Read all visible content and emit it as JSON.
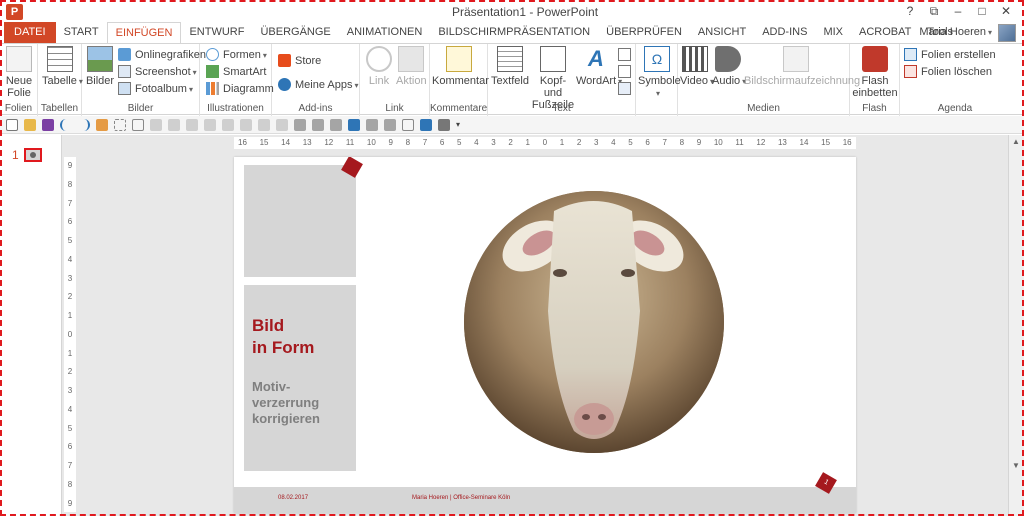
{
  "window": {
    "title": "Präsentation1 - PowerPoint",
    "help": "?",
    "ribbon_opts": "⧉",
    "minimize": "–",
    "maximize": "□",
    "close": "✕"
  },
  "app_logo": "P",
  "tabs": [
    "DATEI",
    "START",
    "EINFÜGEN",
    "ENTWURF",
    "ÜBERGÄNGE",
    "ANIMATIONEN",
    "BILDSCHIRMPRÄSENTATION",
    "ÜBERPRÜFEN",
    "ANSICHT",
    "ADD-INS",
    "MIX",
    "ACROBAT",
    "Tools"
  ],
  "active_tab": "EINFÜGEN",
  "user": {
    "name": "Maria Hoeren"
  },
  "ribbon": {
    "folien": {
      "label": "Folien",
      "neue_folie": "Neue\nFolie"
    },
    "tabellen": {
      "label": "Tabellen",
      "tabelle": "Tabelle"
    },
    "bilder": {
      "label": "Bilder",
      "bilder": "Bilder",
      "onlinegrafiken": "Onlinegrafiken",
      "screenshot": "Screenshot",
      "fotoalbum": "Fotoalbum"
    },
    "illustrationen": {
      "label": "Illustrationen",
      "formen": "Formen",
      "smartart": "SmartArt",
      "diagramm": "Diagramm"
    },
    "addins": {
      "label": "Add-ins",
      "store": "Store",
      "meine_apps": "Meine Apps"
    },
    "link": {
      "label": "Link",
      "link": "Link",
      "aktion": "Aktion"
    },
    "kommentare": {
      "label": "Kommentare",
      "kommentar": "Kommentar"
    },
    "text": {
      "label": "Text",
      "textfeld": "Textfeld",
      "kopf_fusszeile": "Kopf- und\nFußzeile",
      "wordart": "WordArt"
    },
    "symbole": {
      "label": "",
      "symbole": "Symbole"
    },
    "medien": {
      "label": "Medien",
      "video": "Video",
      "audio": "Audio",
      "bildschirmaufzeichnung": "Bildschirmaufzeichnung"
    },
    "flash": {
      "label": "Flash",
      "flash_einbetten": "Flash\neinbetten"
    },
    "agenda": {
      "label": "Agenda",
      "folien_erstellen": "Folien erstellen",
      "folien_loeschen": "Folien löschen"
    }
  },
  "thumbnail": {
    "number": "1"
  },
  "ruler": {
    "h": [
      "16",
      "15",
      "14",
      "13",
      "12",
      "11",
      "10",
      "9",
      "8",
      "7",
      "6",
      "5",
      "4",
      "3",
      "2",
      "1",
      "0",
      "1",
      "2",
      "3",
      "4",
      "5",
      "6",
      "7",
      "8",
      "9",
      "10",
      "11",
      "12",
      "13",
      "14",
      "15",
      "16"
    ],
    "v": [
      "9",
      "8",
      "7",
      "6",
      "5",
      "4",
      "3",
      "2",
      "1",
      "0",
      "1",
      "2",
      "3",
      "4",
      "5",
      "6",
      "7",
      "8",
      "9"
    ]
  },
  "slide": {
    "heading": "Bild\nin Form",
    "subheading": "Motiv-\nverzerrung\nkorrigieren",
    "footer_date": "08.02.2017",
    "footer_text": "Maria Hoeren | Office-Seminare Köln",
    "page_number": "1"
  },
  "colors": {
    "accent": "#d24726",
    "slide_red": "#a5191e",
    "slide_gray": "#d6d6d6"
  }
}
